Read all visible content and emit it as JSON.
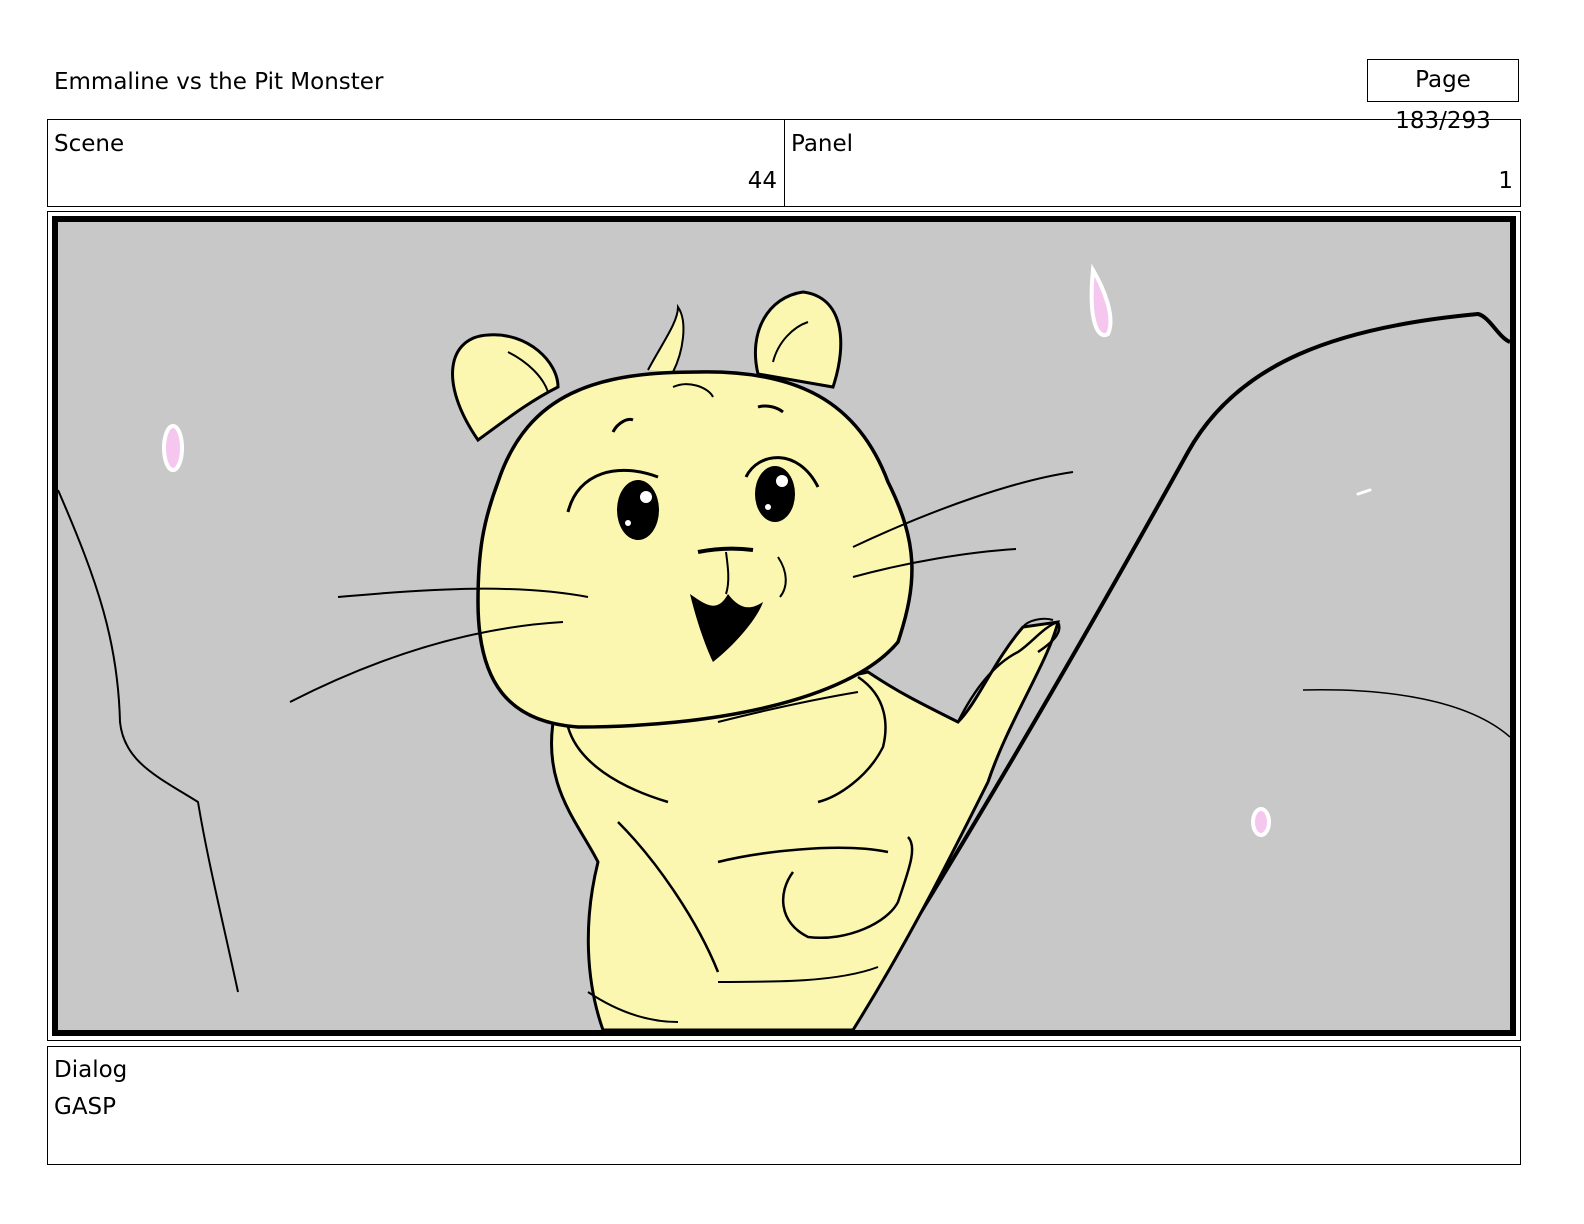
{
  "header": {
    "title": "Emmaline vs the Pit Monster",
    "page": "Page 183/293"
  },
  "scene": {
    "label": "Scene",
    "value": "44"
  },
  "panel": {
    "label": "Panel",
    "value": "1"
  },
  "illustration": {
    "subject": "hamster-character-gasping",
    "colors": {
      "background": "#c8c8c8",
      "character_fill": "#fbf7b0",
      "petal_fill": "#f5c6ee",
      "line": "#000000"
    }
  },
  "dialog": {
    "label": "Dialog",
    "text": "GASP"
  }
}
